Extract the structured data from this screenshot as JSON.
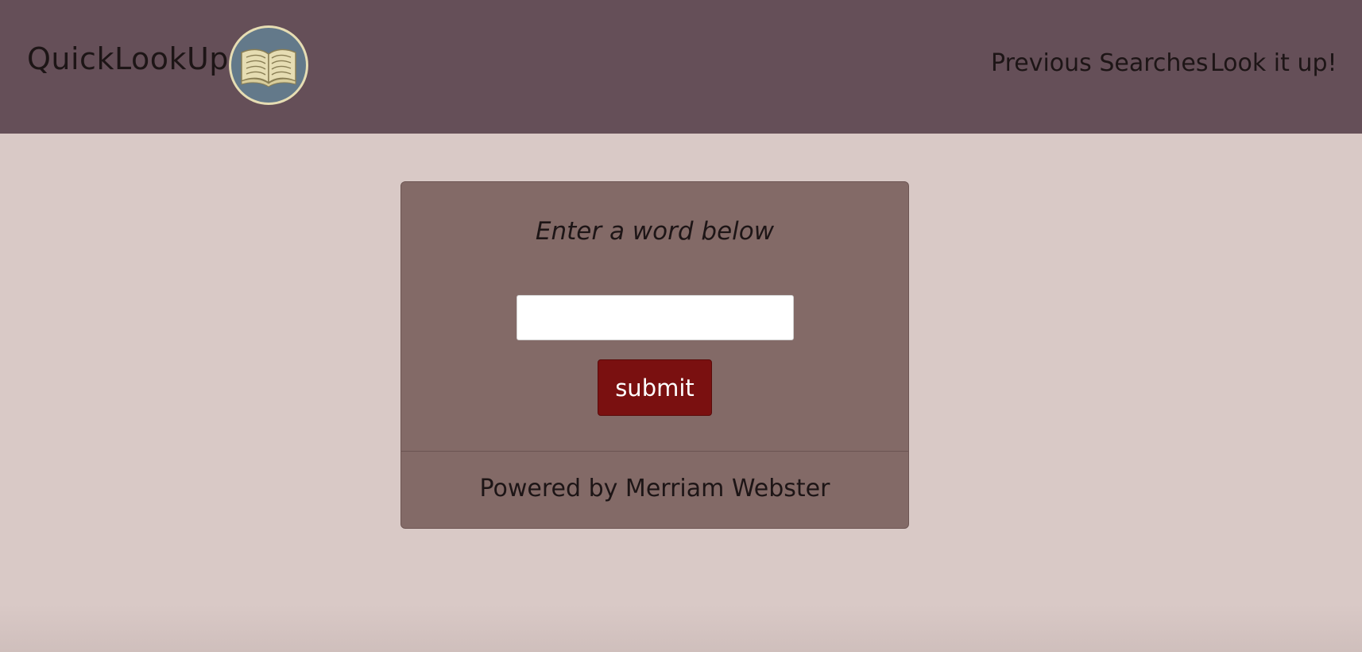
{
  "navbar": {
    "brand": "QuickLookUp",
    "logo_icon": "open-book-icon",
    "links": [
      {
        "label": "Previous Searches"
      },
      {
        "label": "Look it up!"
      }
    ]
  },
  "search_card": {
    "title": "Enter a word below",
    "input": {
      "value": "",
      "placeholder": ""
    },
    "submit_label": "submit",
    "footer": "Powered by Merriam Webster"
  },
  "colors": {
    "navbar_bg": "#654f58",
    "page_bg": "#d9c9c6",
    "card_bg": "#836a67",
    "submit_bg": "#7a1010",
    "logo_ring": "#e6ddb3",
    "logo_fill": "#63798a"
  }
}
